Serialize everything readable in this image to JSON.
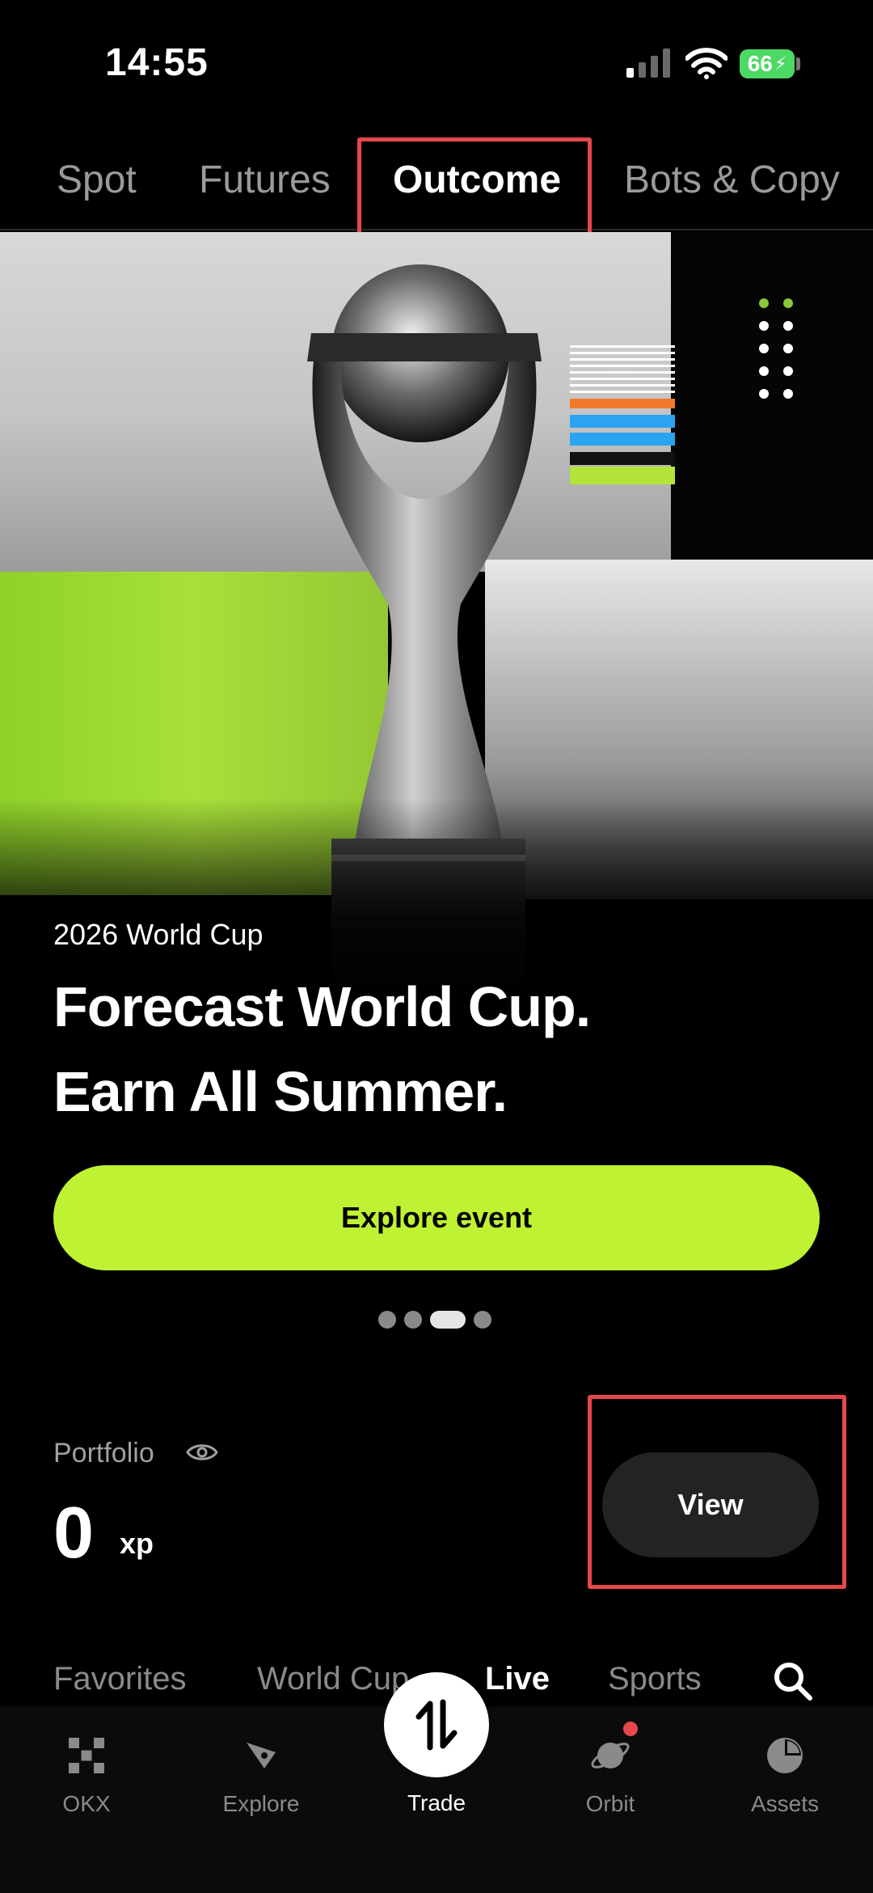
{
  "status_bar": {
    "time": "14:55",
    "battery_level": "66"
  },
  "top_tabs": [
    {
      "label": "Spot",
      "active": false
    },
    {
      "label": "Futures",
      "active": false
    },
    {
      "label": "Outcome",
      "active": true
    },
    {
      "label": "Bots & Copy",
      "active": false
    }
  ],
  "hero": {
    "subtitle": "2026 World Cup",
    "title_line1": "Forecast World Cup.",
    "title_line2": "Earn All Summer.",
    "cta_label": "Explore event",
    "pager_total": 4,
    "pager_active_index": 2
  },
  "portfolio": {
    "label": "Portfolio",
    "value": "0",
    "unit": "xp",
    "view_label": "View"
  },
  "category_tabs": [
    {
      "label": "Favorites",
      "active": false
    },
    {
      "label": "World Cup",
      "active": false
    },
    {
      "label": "Live",
      "active": true
    },
    {
      "label": "Sports",
      "active": false
    }
  ],
  "bottom_nav": [
    {
      "label": "OKX",
      "icon": "okx-logo-icon"
    },
    {
      "label": "Explore",
      "icon": "compass-icon"
    },
    {
      "label": "Trade",
      "icon": "swap-arrows-icon",
      "active": true
    },
    {
      "label": "Orbit",
      "icon": "planet-icon",
      "badge": true
    },
    {
      "label": "Assets",
      "icon": "pie-chart-icon"
    }
  ],
  "colors": {
    "accent_lime": "#bff232",
    "highlight_red": "#e5484d",
    "battery_green": "#4cd964"
  }
}
